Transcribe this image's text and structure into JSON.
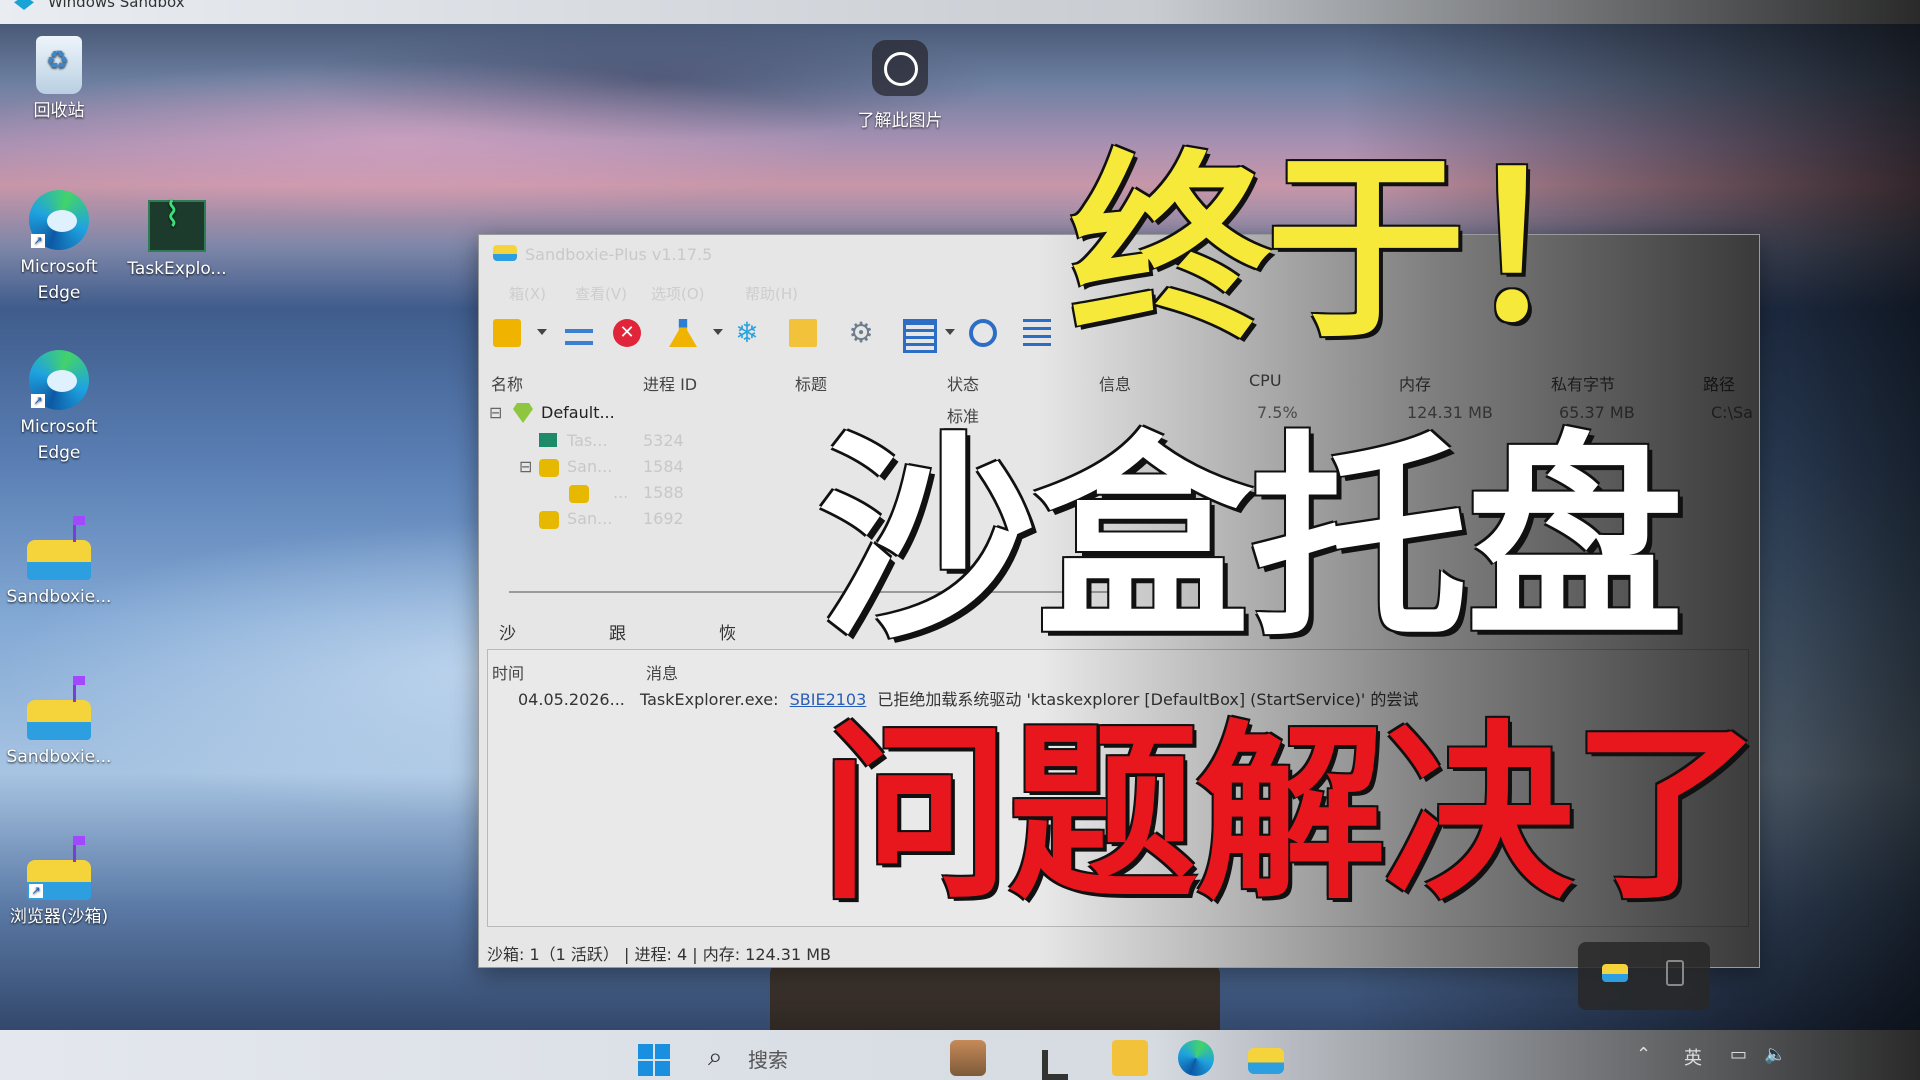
{
  "window_title": "Windows Sandbox",
  "desktop": {
    "icons": [
      {
        "label": "回收站",
        "icon": "recycle-bin-icon"
      },
      {
        "label": "Microsoft\nEdge",
        "icon": "edge-icon"
      },
      {
        "label": "TaskExplo...",
        "icon": "task-explorer-icon"
      },
      {
        "label": "Microsoft\nEdge",
        "icon": "edge-icon"
      },
      {
        "label": "Sandboxie...",
        "icon": "sandboxie-icon"
      },
      {
        "label": "Sandboxie...",
        "icon": "sandboxie-icon"
      },
      {
        "label": "浏览器(沙箱)",
        "icon": "sandboxie-icon"
      }
    ],
    "learn_label": "了解此图片"
  },
  "app": {
    "title": "Sandboxie-Plus v1.17.5",
    "menu": [
      "箱(X)",
      "查看(V)",
      "选项(O)",
      "帮助(H)"
    ],
    "columns": [
      "名称",
      "进程 ID",
      "标题",
      "状态",
      "信息",
      "CPU",
      "内存",
      "私有字节",
      "路径"
    ],
    "tree": {
      "box_name": "Default...",
      "box_status": "标准",
      "box_cpu": "7.5%",
      "box_mem": "124.31 MB",
      "box_private": "65.37 MB",
      "box_path": "C:\\Sa",
      "processes": [
        {
          "name": "Tas...",
          "pid": "5324"
        },
        {
          "name": "San...",
          "pid": "1584"
        },
        {
          "name": "...",
          "pid": "1588"
        },
        {
          "name": "San...",
          "pid": "1692"
        }
      ]
    },
    "tabs": [
      "沙箱消息",
      "跟踪日志",
      "恢复日志"
    ],
    "log_columns": [
      "时间",
      "消息"
    ],
    "log_row": {
      "time": "04.05.2026...",
      "prefix": "TaskExplorer.exe:",
      "code": "SBIE2103",
      "message": "已拒绝加载系统驱动 'ktaskexplorer [DefaultBox] (StartService)' 的尝试"
    },
    "status_bar": "沙箱: 1（1 活跃） | 进程: 4 | 内存: 124.31 MB"
  },
  "headline": {
    "line1": "终于！",
    "line2": "沙盒托盘",
    "line3": "问题解决了",
    "colors": {
      "line1": "#f7e93a",
      "line2": "#ffffff",
      "line3": "#e8161d"
    }
  },
  "taskbar": {
    "search_label": "搜索",
    "tray_lang": "英"
  }
}
